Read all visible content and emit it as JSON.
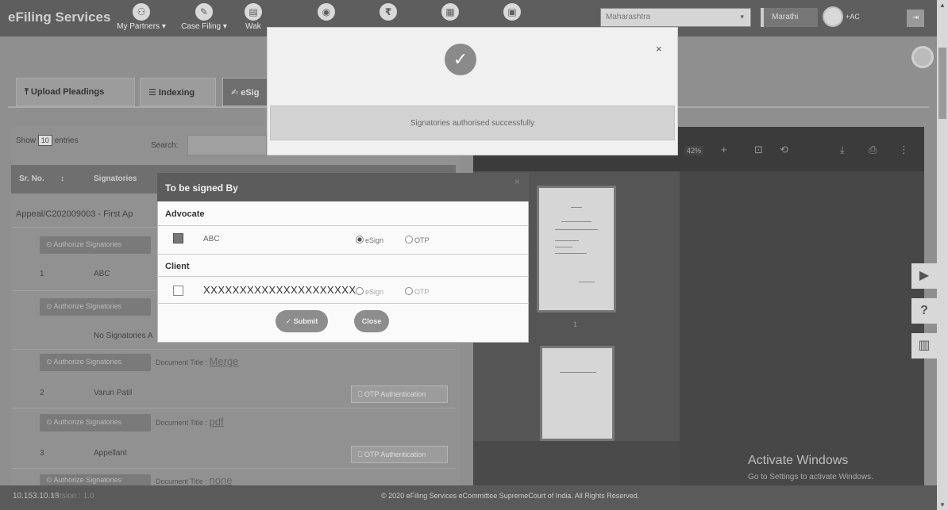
{
  "app": {
    "brand": "eFiling Services"
  },
  "nav": {
    "items": [
      {
        "label": "My Partners ▾",
        "icon": "users-icon"
      },
      {
        "label": "Case Filing ▾",
        "icon": "pencil-icon"
      },
      {
        "label": "Wak",
        "icon": "doc-icon"
      },
      {
        "label": "",
        "icon": "ia-icon"
      },
      {
        "label": "",
        "icon": "rupee-icon"
      },
      {
        "label": "",
        "icon": "file-icon"
      },
      {
        "label": "",
        "icon": "calendar-icon"
      }
    ],
    "state_select": "Maharashtra",
    "lang_button": "Marathi",
    "user_label": "+AC"
  },
  "tabs": [
    {
      "label": "⤒ Upload Pleadings"
    },
    {
      "label": "☰ Indexing"
    },
    {
      "label": "✍ eSig"
    }
  ],
  "table": {
    "show_label": "Show",
    "show_value": "10",
    "entries_label": "entries",
    "search_label": "Search:",
    "headers": [
      "Sr. No.",
      "Signatories"
    ],
    "group_title": "Appeal/C202009003 - First Ap",
    "authorize_label": "⊙ Authorize Signatories",
    "rows": [
      {
        "sr": "1",
        "name": "ABC"
      },
      {
        "sr": "",
        "name": "No Signatories A"
      },
      {
        "sr": "2",
        "name": "Varun Patil"
      },
      {
        "sr": "3",
        "name": "Appellant"
      }
    ],
    "doc_title_label": "Document Title :",
    "doc_links": [
      "Merge",
      "pdf",
      "none"
    ],
    "otp_label": "⎕ OTP Authentication"
  },
  "pdf": {
    "zoom": "42%",
    "page_number": "1"
  },
  "success_modal": {
    "message": "Signatories authorised successfully",
    "close": "×"
  },
  "sign_modal": {
    "title": "To be signed By",
    "close": "×",
    "advocate_label": "Advocate",
    "advocate_name": "ABC",
    "client_label": "Client",
    "client_name": "XXXXXXXXXXXXXXXXXXXXX",
    "esign_label": "eSign",
    "otp_label": "OTP",
    "submit_label": "✓ Submit",
    "close_label": "Close"
  },
  "watermark": {
    "title": "Activate Windows",
    "subtitle": "Go to Settings to activate Windows."
  },
  "footer": {
    "ip": "10.153.10.13",
    "version": "version : 1.0",
    "copyright": "© 2020 eFiling Services eCommittee SupremeCourt of India. All Rights Reserved."
  }
}
